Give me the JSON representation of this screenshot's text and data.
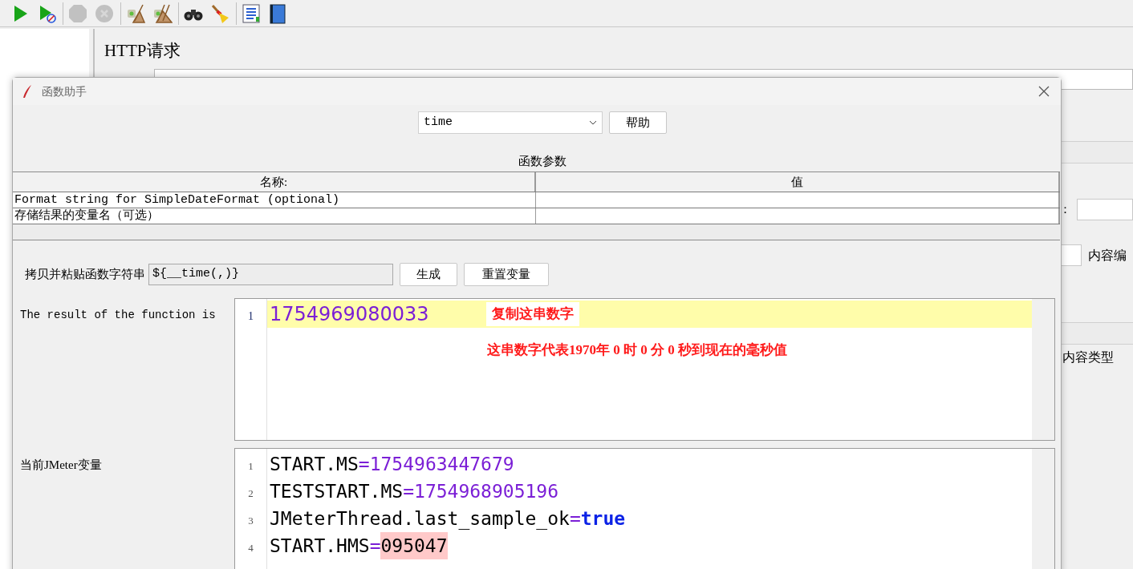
{
  "toolbar": {
    "buttons": [
      {
        "kind": "start",
        "disabled": false
      },
      {
        "kind": "start-no-pause",
        "disabled": false
      },
      {
        "kind": "stop",
        "disabled": true
      },
      {
        "kind": "shutdown",
        "disabled": true
      },
      {
        "kind": "clear",
        "disabled": false
      },
      {
        "kind": "clear-all",
        "disabled": false
      },
      {
        "kind": "search",
        "disabled": false
      },
      {
        "kind": "reset-search",
        "disabled": false
      },
      {
        "kind": "function-helper",
        "disabled": false
      },
      {
        "kind": "help",
        "disabled": false
      }
    ]
  },
  "main_panel": {
    "title": "HTTP请求",
    "colon_label": "：",
    "encoding_label": "内容编",
    "content_type_label": "内容类型"
  },
  "dialog": {
    "title": "函数助手",
    "function_select": {
      "value": "time"
    },
    "help_button": "帮助",
    "params_title": "函数参数",
    "params_table": {
      "columns": [
        "名称:",
        "值"
      ],
      "rows": [
        {
          "name": "Format string for SimpleDateFormat (optional)",
          "value": ""
        },
        {
          "name": "存储结果的变量名（可选）",
          "value": ""
        }
      ]
    },
    "copy_label": "拷贝并粘贴函数字符串",
    "copy_field": {
      "value": "${__time(,)}"
    },
    "generate_button": "生成",
    "reset_button": "重置变量",
    "result_label": "The result of the function is",
    "result": {
      "line_number": "1",
      "value": "1754969080033",
      "note": "复制这串数字",
      "explanation": "这串数字代表1970年 0 时 0 分 0 秒到现在的毫秒值"
    },
    "vars_label": "当前JMeter变量",
    "vars": [
      {
        "line_number": "1",
        "key": "START.MS",
        "sign": "=",
        "value": "1754963447679",
        "kind": "number"
      },
      {
        "line_number": "2",
        "key": "TESTSTART.MS",
        "sign": "=",
        "value": "1754968905196",
        "kind": "number"
      },
      {
        "line_number": "3",
        "key": "JMeterThread.last_sample_ok",
        "sign": "=",
        "value": "true",
        "kind": "keyword"
      },
      {
        "line_number": "4",
        "key": "START.HMS",
        "sign": "=",
        "value": "095047",
        "kind": "marked"
      }
    ]
  }
}
